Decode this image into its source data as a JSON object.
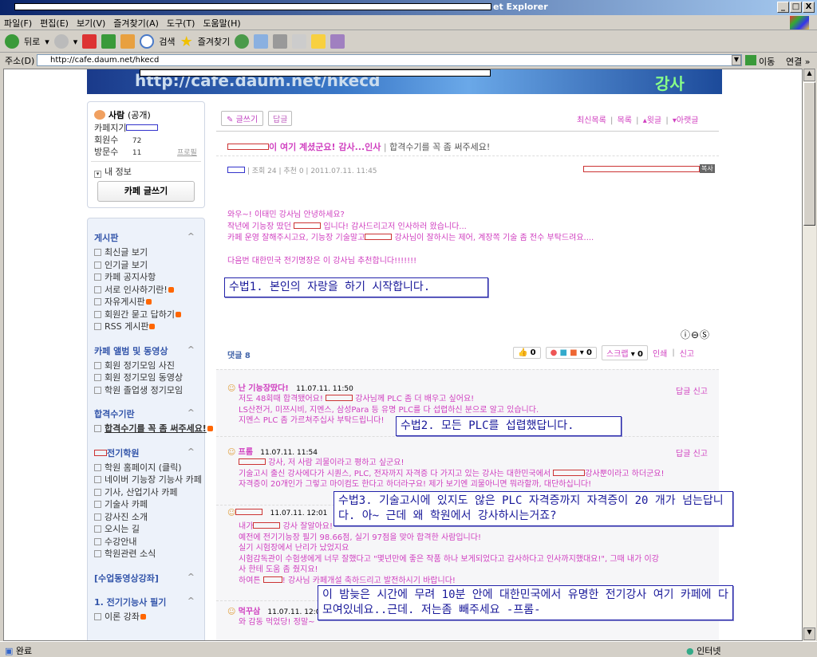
{
  "window": {
    "title_suffix": "et Explorer",
    "min": "_",
    "max": "□",
    "close": "X"
  },
  "menu": [
    "파일(F)",
    "편집(E)",
    "보기(V)",
    "즐겨찾기(A)",
    "도구(T)",
    "도움말(H)"
  ],
  "toolbar": {
    "back": "뒤로",
    "search": "검색",
    "favorites": "즐겨찾기"
  },
  "address": {
    "label": "주소(D)",
    "url": "http://cafe.daum.net/hkecd",
    "go": "이동",
    "links": "연결 »"
  },
  "status": {
    "left": "완료",
    "zone": "인터넷"
  },
  "banner": {
    "text": "http://cafe.daum.net/hkecd",
    "right": "강사"
  },
  "profile": {
    "name": "사람",
    "visibility": "(공개)",
    "manager_label": "카페지기",
    "members_label": "회원수",
    "members": "72",
    "visits_label": "방문수",
    "visits": "11",
    "profile_link": "프로필",
    "myinfo": "내 정보",
    "write": "카페 글쓰기"
  },
  "sidebar": [
    {
      "title": "게시판",
      "items": [
        "최신글 보기",
        "인기글 보기",
        "카페 공지사항",
        "서로 인사하기란!",
        "자유게시판",
        "회원간 묻고 답하기",
        "RSS 게시판"
      ]
    },
    {
      "title": "카페 앨범 및 동영상",
      "items": [
        "회원 정기모임 사진",
        "회원 정기모임 동영상",
        "학원 졸업생 정기모임"
      ]
    },
    {
      "title": "합격수기란",
      "items": [
        "합격수기를 꼭 좀 써주세요!"
      ]
    },
    {
      "title": "전기학원",
      "items": [
        "학원 홈페이지 (클릭)",
        "네이버 기능장 기능사 카페",
        "기사, 산업기사 카페",
        "기술사 카페",
        "강사진 소개",
        "오시는 길",
        "수강안내",
        "학원관련 소식"
      ]
    },
    {
      "title": "[수업동영상강좌]",
      "items": []
    },
    {
      "title": "1. 전기기능사 필기",
      "items": [
        "이론 강좌"
      ]
    }
  ],
  "post": {
    "write_btn": "글쓰기",
    "reply_btn": "답글",
    "nav": [
      "최신목록",
      "목록",
      "윗글",
      "아랫글"
    ],
    "title": "이 여기 계셨군요! 감사...인사",
    "board": "합격수기를 꼭 좀 써주세요!",
    "views": "조회 24",
    "recommend": "추천 0",
    "date": "2011.07.11. 11:45",
    "copy": "복사",
    "body": [
      "와우~! 이태민 강사님 안녕하세요?",
      "작년에 기능장 땄던",
      "입니다! 감사드리고저 인사하러 왔습니다...",
      "카페 운영 잘해주시고요, 기능장 기술말고",
      "강사님이 잘하시는 제어, 계장쪽 기술 좀 전수 부탁드려요....",
      "다음번 대한민국 전기명장은 이 강사님 추천합니다!!!!!!!"
    ],
    "comments_label": "댓글 8",
    "like": "0",
    "share": "0",
    "scrap": "스크랩",
    "scrap_count": "0",
    "print": "인쇄",
    "report": "신고"
  },
  "comments": [
    {
      "author": "난 기능장땄다!",
      "date": "11.07.11. 11:50",
      "lines": [
        "저도 48회때 합격됐어요!",
        "강사님께 PLC 좀 더 배우고 싶어요!",
        "LS산전거, 미쯔시비, 지멘스, 삼성Para 등 유명 PLC를 다 섭렵하신 분으로 알고 있습니다.",
        "지멘스 PLC 좀 가르쳐주십사 부탁드립니다!"
      ]
    },
    {
      "author": "프롬",
      "date": "11.07.11. 11:54",
      "lines": [
        "강사, 저 사람 괴물이라고 평하고 싶군요!",
        "기술고시 출신 강사에다가 시퀀스, PLC, 전자까지 자격증 다 가지고 있는 강사는 대한민국에서",
        "강사뿐이라고 하더군요!",
        "자격증이 20개인가 그렇고 마이컴도 한다고 하더라구요! 제가 보기엔 괴물아니면 뭐라할까, 대단하십니다!"
      ]
    },
    {
      "author": "",
      "date": "11.07.11. 12:01",
      "lines": [
        "내가",
        "강사 잘알아요!",
        "예전에 전기기능장 필기 98.66점, 실기 97점을 맞아 합격한 사람입니다!",
        "실기 시험장에서 난리가 났었지요",
        "시험감독관이 수험생에게 너무 잘했다고 \"몇년만에 좋은 작품 하나 보게되었다고 감사하다고 인사까지했대요!\", 그때 내가 이강",
        "사 한테 도움 좀 줬지요!",
        "하여튼",
        "! 강사님 카페개설 축하드리고 발전하시기 바랍니다!"
      ]
    },
    {
      "author": "먹꾸삼",
      "date": "11.07.11. 12:04",
      "lines": [
        "와 감동 먹었당! 정말~"
      ]
    }
  ],
  "comment_actions": {
    "reply": "답글",
    "report": "신고"
  },
  "annotations": [
    "수법1. 본인의 자랑을 하기 시작합니다.",
    "수법2. 모든 PLC를 섭렵했답니다.",
    "수법3. 기술고시에 있지도 않은 PLC 자격증까지 자격증이 20 개가 넘는답니다. 아~ 근데 왜 학원에서 강사하시는거죠?",
    "이 밤늦은 시간에 무려 10분 안에 대한민국에서 유명한 전기강사 여기 카페에 다 모여있네요..근데. 저는좀 빼주세요 -프롬-"
  ]
}
